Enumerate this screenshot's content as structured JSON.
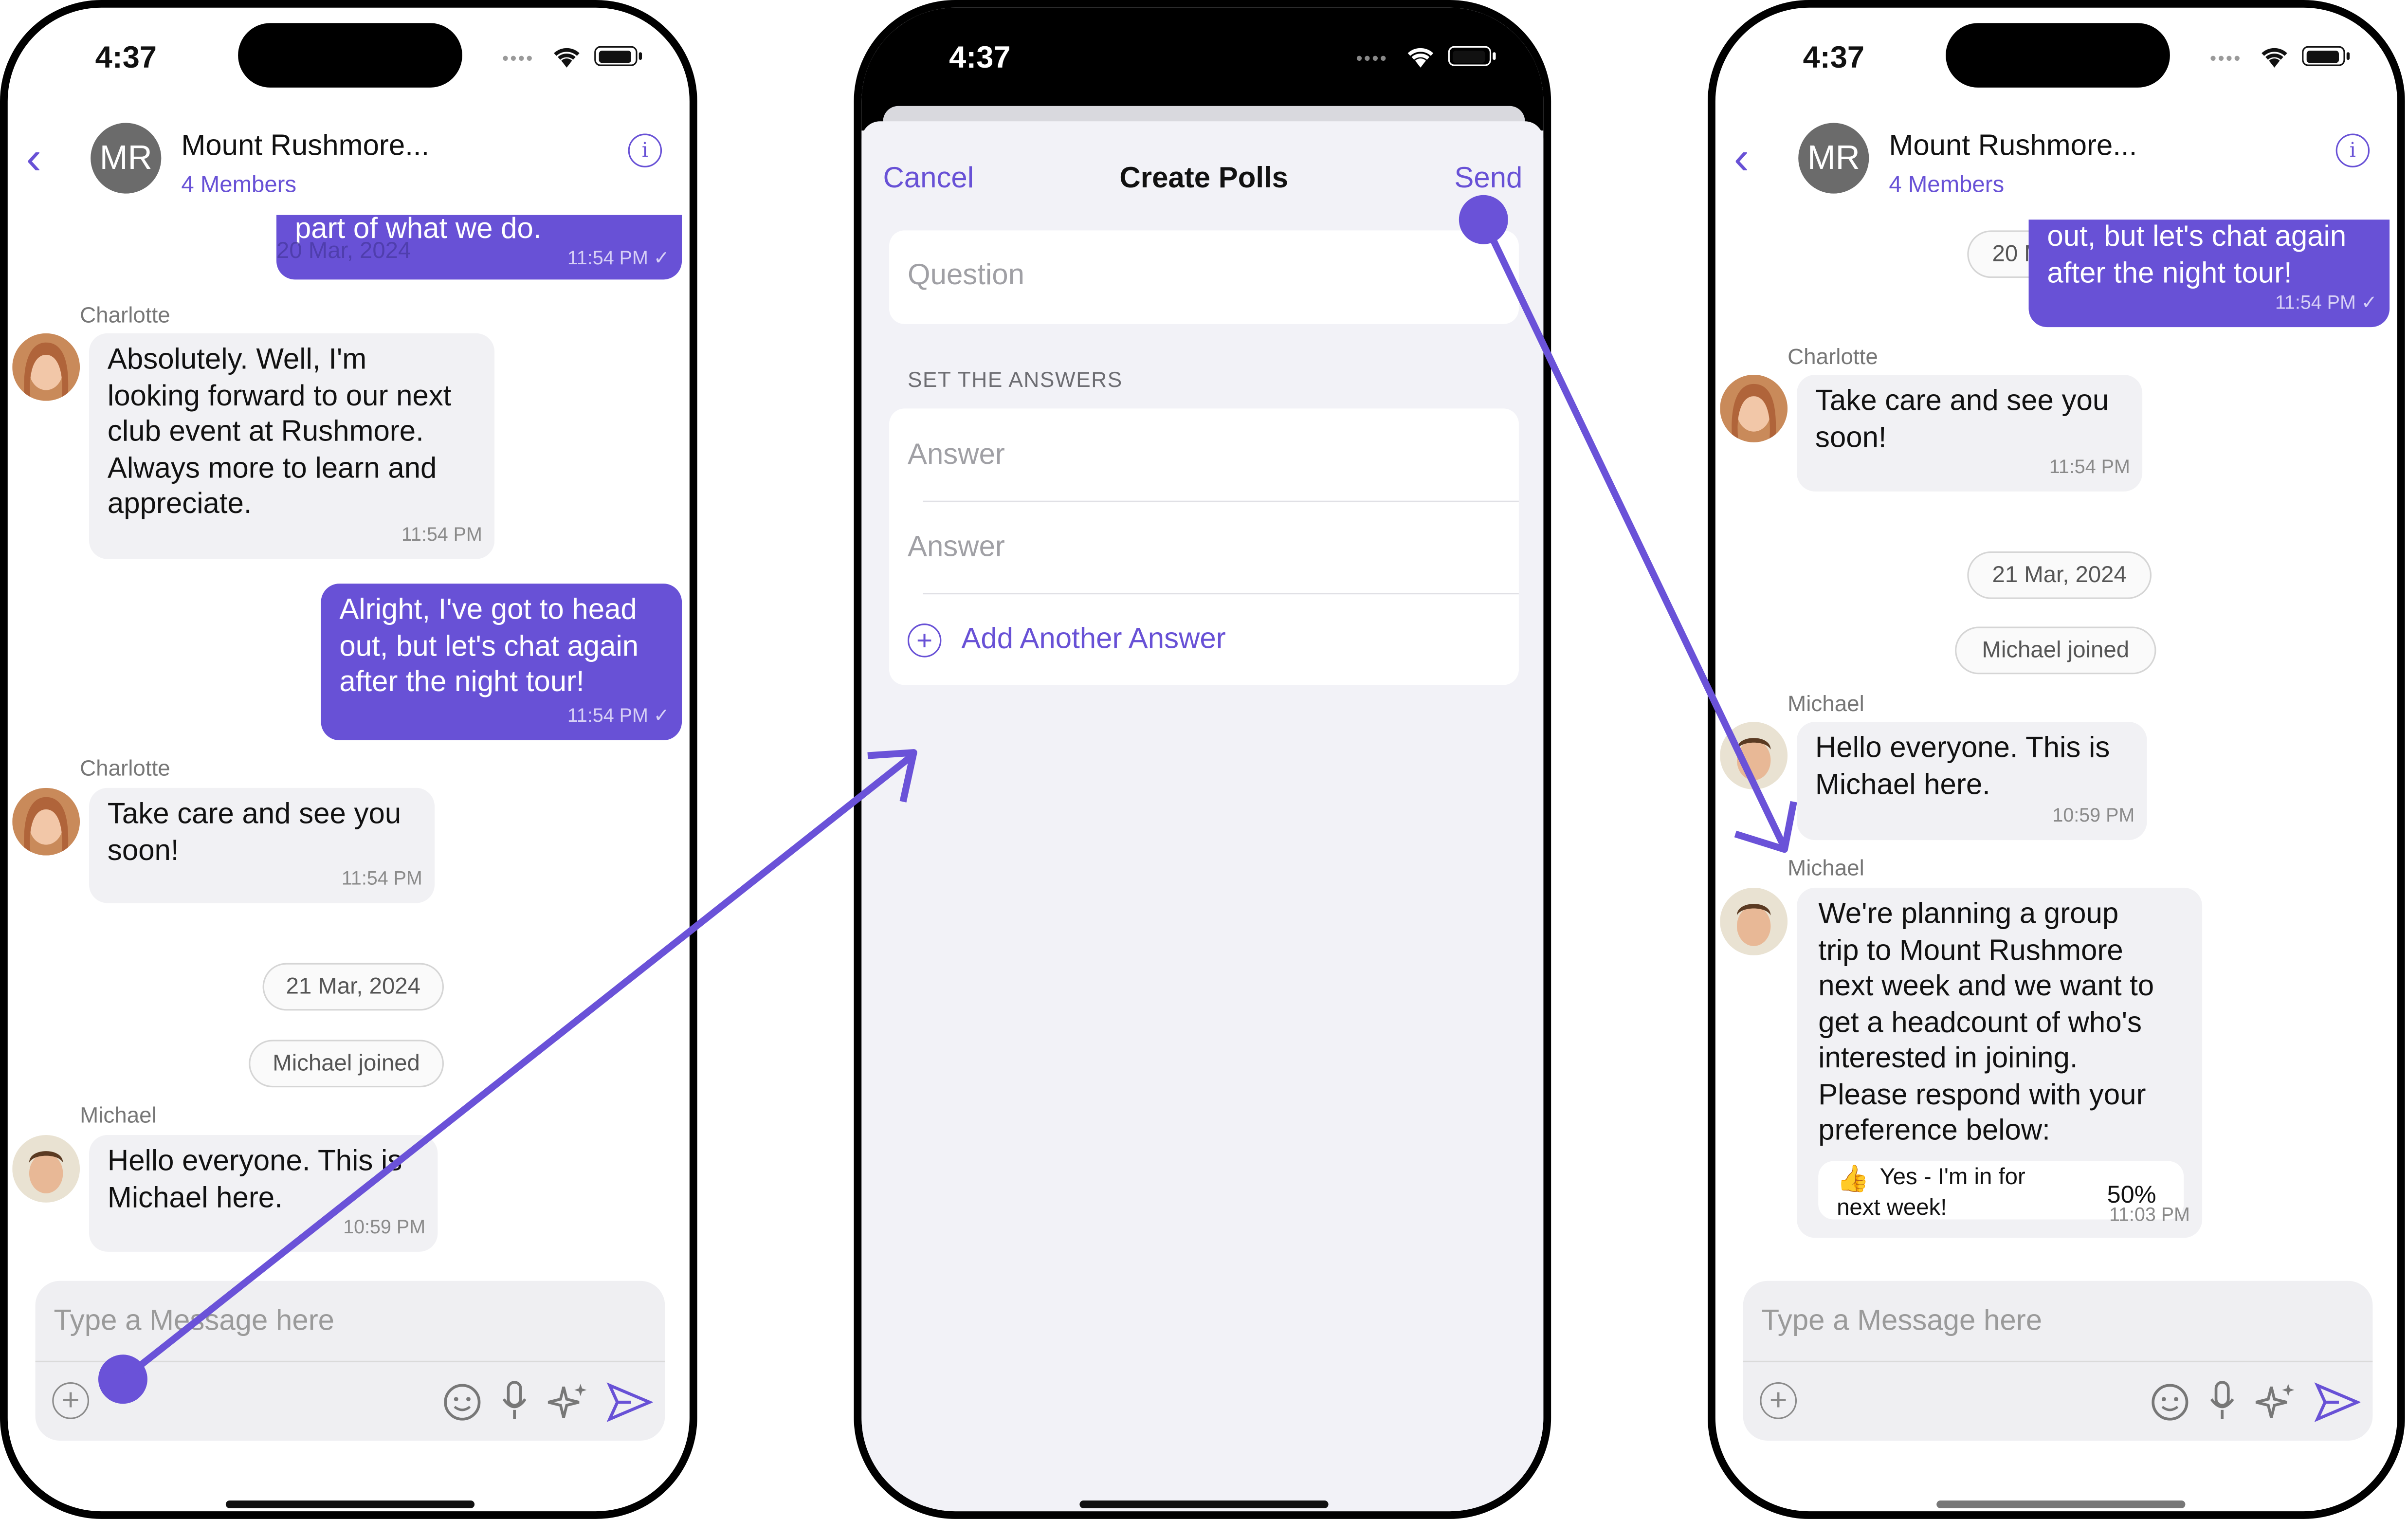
{
  "status_bar": {
    "time": "4:37",
    "dots": "••••"
  },
  "chat_header": {
    "avatar_initials": "MR",
    "title": "Mount Rushmore...",
    "members": "4 Members"
  },
  "screen1": {
    "top_out": {
      "text": "part of what we do.",
      "date_overlay": "20 Mar, 2024",
      "time": "11:54 PM ✓"
    },
    "msg1": {
      "sender": "Charlotte",
      "lines": [
        "Absolutely. Well, I'm",
        "looking forward to our next",
        "club event at Rushmore.",
        "Always more to learn and",
        "appreciate."
      ],
      "time": "11:54 PM"
    },
    "msg2": {
      "lines": [
        "Alright, I've got to head",
        "out, but let's chat again",
        "after the night tour!"
      ],
      "time": "11:54 PM ✓"
    },
    "msg3": {
      "sender": "Charlotte",
      "lines": [
        "Take care and see you",
        "soon!"
      ],
      "time": "11:54 PM"
    },
    "date_pill": "21 Mar, 2024",
    "joined_pill": "Michael joined",
    "msg4": {
      "sender": "Michael",
      "lines": [
        "Hello everyone. This is",
        "Michael here."
      ],
      "time": "10:59 PM"
    }
  },
  "composer": {
    "placeholder": "Type a Message here"
  },
  "poll_screen": {
    "cancel": "Cancel",
    "title": "Create Polls",
    "send": "Send",
    "question_placeholder": "Question",
    "section_label": "SET THE ANSWERS",
    "answer1_placeholder": "Answer",
    "answer2_placeholder": "Answer",
    "add_answer": "Add Another Answer"
  },
  "screen3": {
    "top_out": {
      "lines": [
        "out, but let's chat again",
        "after the night tour!"
      ],
      "date_overlay": "20 Mar, 2024",
      "time": "11:54 PM ✓"
    },
    "msg1": {
      "sender": "Charlotte",
      "lines": [
        "Take care and see you",
        "soon!"
      ],
      "time": "11:54 PM"
    },
    "date_pill": "21 Mar, 2024",
    "joined_pill": "Michael joined",
    "msg2": {
      "sender": "Michael",
      "lines": [
        "Hello everyone. This is",
        "Michael here."
      ],
      "time": "10:59 PM"
    },
    "poll_msg": {
      "sender": "Michael",
      "lines": [
        "We're planning a group",
        "trip to Mount Rushmore",
        "next week and we want to",
        "get a headcount of who's",
        "interested in joining.",
        "Please respond with your",
        "preference below:"
      ],
      "option_emoji": "👍",
      "option_line1": "Yes - I'm in for",
      "option_line2": "next week!",
      "option_percent": "50%",
      "time": "11:03 PM"
    }
  },
  "colors": {
    "accent": "#6851d6",
    "bubble_in": "#f1f1f4",
    "arrow": "#6a52d8"
  }
}
